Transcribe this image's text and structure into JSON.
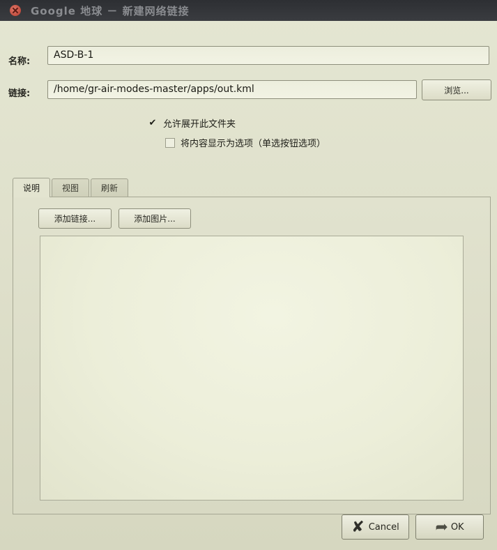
{
  "window": {
    "title": "Google 地球 － 新建网络链接"
  },
  "form": {
    "name_label": "名称:",
    "name_value": "ASD-B-1",
    "link_label": "链接:",
    "link_value": "/home/gr-air-modes-master/apps/out.kml",
    "browse_label": "浏览..."
  },
  "options": {
    "allow_expand": {
      "label": "允许展开此文件夹",
      "checked": true,
      "checkmark": "✔"
    },
    "show_as_options": {
      "label": "将内容显示为选项（单选按钮选项）",
      "checked": false
    }
  },
  "tabs": [
    {
      "label": "说明",
      "active": true
    },
    {
      "label": "视图",
      "active": false
    },
    {
      "label": "刷新",
      "active": false
    }
  ],
  "description_panel": {
    "add_link_label": "添加链接...",
    "add_image_label": "添加图片...",
    "description_text": ""
  },
  "footer": {
    "cancel_label": "Cancel",
    "ok_label": "OK"
  },
  "icons": {
    "close": "close-icon",
    "cancel": "cancel-x-icon",
    "ok": "ok-arrow-icon",
    "check": "checkmark-icon"
  }
}
